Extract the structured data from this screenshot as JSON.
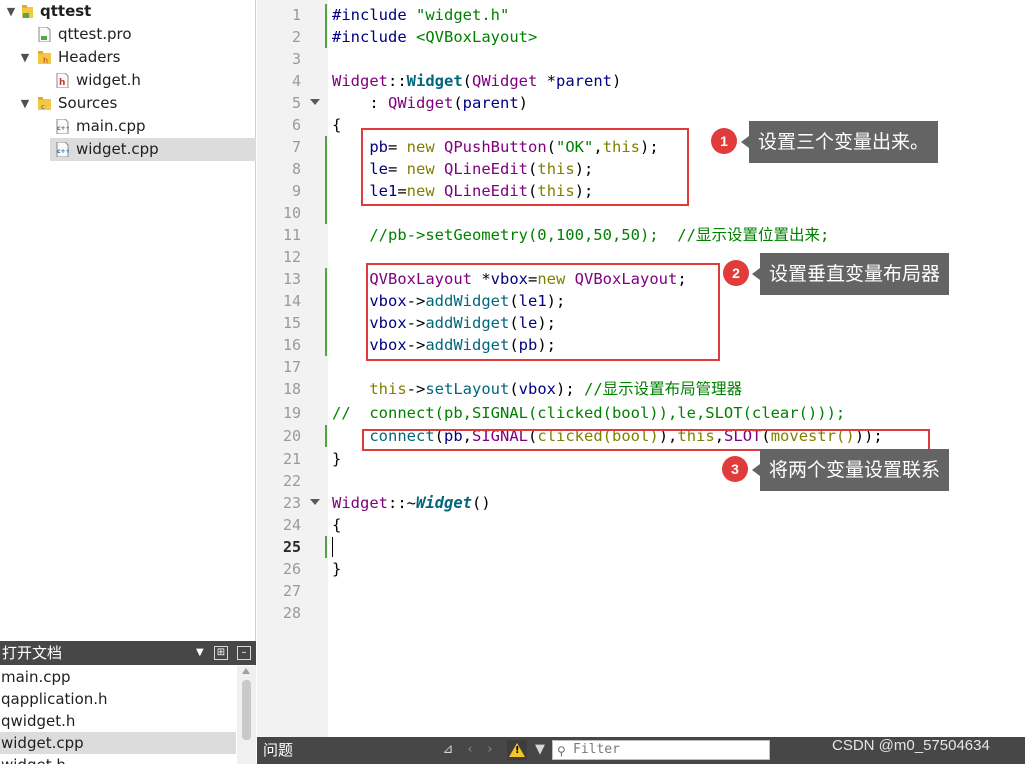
{
  "project_tree": {
    "project": "qttest",
    "items": [
      {
        "label": "qttest.pro"
      },
      {
        "label": "Headers"
      },
      {
        "label": "widget.h"
      },
      {
        "label": "Sources"
      },
      {
        "label": "main.cpp"
      },
      {
        "label": "widget.cpp"
      }
    ]
  },
  "open_documents": {
    "title": "打开文档",
    "items": [
      "main.cpp",
      "qapplication.h",
      "qwidget.h",
      "widget.cpp",
      "widget.h"
    ]
  },
  "editor": {
    "line_numbers": [
      "1",
      "2",
      "3",
      "4",
      "5",
      "6",
      "7",
      "8",
      "9",
      "10",
      "11",
      "12",
      "13",
      "14",
      "15",
      "16",
      "17",
      "18",
      "19",
      "20",
      "21",
      "22",
      "23",
      "24",
      "25",
      "26",
      "27",
      "28"
    ],
    "current_line": "25"
  },
  "annotations": [
    {
      "number": "1",
      "text": "设置三个变量出来。"
    },
    {
      "number": "2",
      "text": "设置垂直变量布局器"
    },
    {
      "number": "3",
      "text": "将两个变量设置联系"
    }
  ],
  "bottom_bar": {
    "issues_label": "问题",
    "filter_placeholder": "Filter"
  },
  "watermark": "CSDN @m0_57504634"
}
